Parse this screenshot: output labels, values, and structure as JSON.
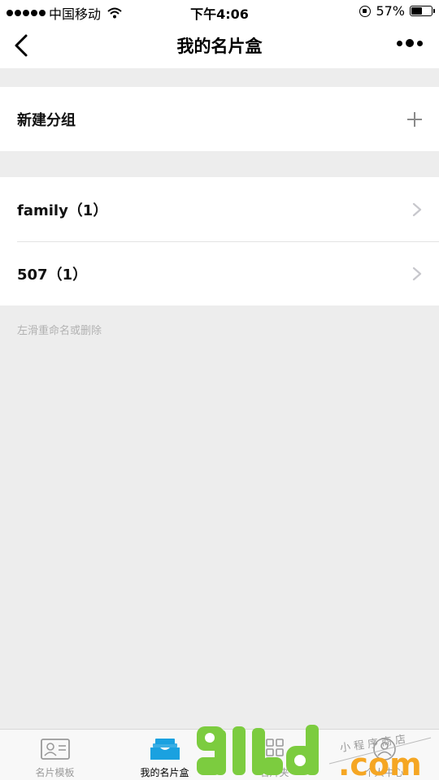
{
  "status_bar": {
    "carrier": "中国移动",
    "time": "下午4:06",
    "battery": "57%",
    "battery_level": 0.57
  },
  "nav": {
    "title": "我的名片盒"
  },
  "new_group": {
    "label": "新建分组"
  },
  "groups": [
    {
      "label": "family（1）"
    },
    {
      "label": "507（1）"
    }
  ],
  "hint": "左滑重命名或删除",
  "tabs": [
    {
      "label": "名片模板",
      "icon": "card-template-icon",
      "active": false
    },
    {
      "label": "我的名片盒",
      "icon": "card-box-icon",
      "active": true
    },
    {
      "label": "名片夹",
      "icon": "card-holder-icon",
      "active": false
    },
    {
      "label": "个人中心",
      "icon": "profile-icon",
      "active": false
    }
  ],
  "watermark": {
    "logo": "91ud.com",
    "tagline": "小程序商店"
  },
  "colors": {
    "accent": "#1aa1e0",
    "background": "#ededed",
    "watermark_green": "#7ccc3f",
    "watermark_orange": "#f5a623"
  }
}
